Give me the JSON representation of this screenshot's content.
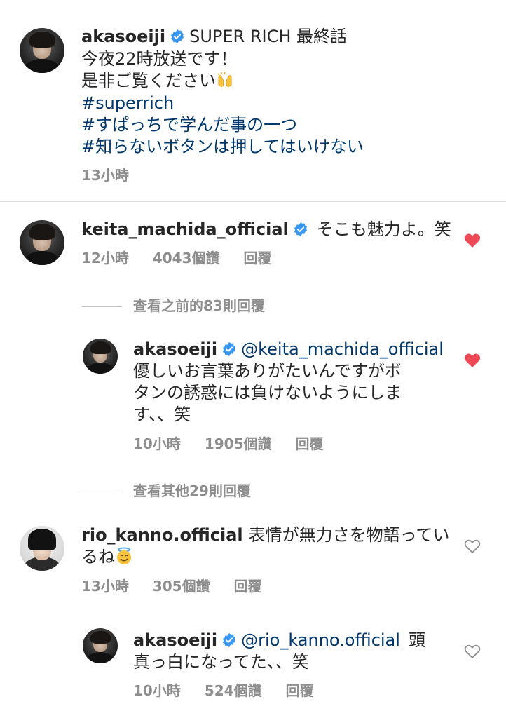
{
  "caption": {
    "username": "akasoeiji",
    "lines": [
      "SUPER RICH  最終話",
      "今夜22時放送です！",
      "是非ご覧ください",
      "#superrich",
      "#すぱっちで学んだ事の一つ",
      "#知らないボタンは押してはいけない"
    ],
    "time": "13小時"
  },
  "comment1": {
    "username": "keita_machida_official",
    "text": "そこも魅力よ。笑",
    "time": "12小時",
    "likes": "4043個讚",
    "reply": "回覆",
    "liked": true
  },
  "view_previous": "查看之前的83則回覆",
  "reply1": {
    "username": "akasoeiji",
    "mention": "@keita_machida_official",
    "text_lines": [
      "優しいお言葉ありがたいんですがボ",
      "タンの誘惑には負けないようにしま",
      "す、、笑"
    ],
    "time": "10小時",
    "likes": "1905個讚",
    "reply": "回覆",
    "liked": true
  },
  "view_other": "查看其他29則回覆",
  "comment2": {
    "username": "rio_kanno.official",
    "text_lines": [
      "表情が無力さを物語ってい",
      "るね"
    ],
    "time": "13小時",
    "likes": "305個讚",
    "reply": "回覆",
    "liked": false
  },
  "reply2": {
    "username": "akasoeiji",
    "mention": "@rio_kanno.official",
    "text_lines": [
      "頭",
      "真っ白になってた、、笑"
    ],
    "time": "10小時",
    "likes": "524個讚",
    "reply": "回覆",
    "liked": false
  },
  "colors": {
    "link": "#00376b",
    "verified": "#3897f0",
    "heart": "#ed4956",
    "meta": "#8e8e8e"
  },
  "icons": [
    "verified-badge-icon",
    "heart-icon",
    "raised-hands-emoji",
    "smiling-halo-emoji"
  ]
}
